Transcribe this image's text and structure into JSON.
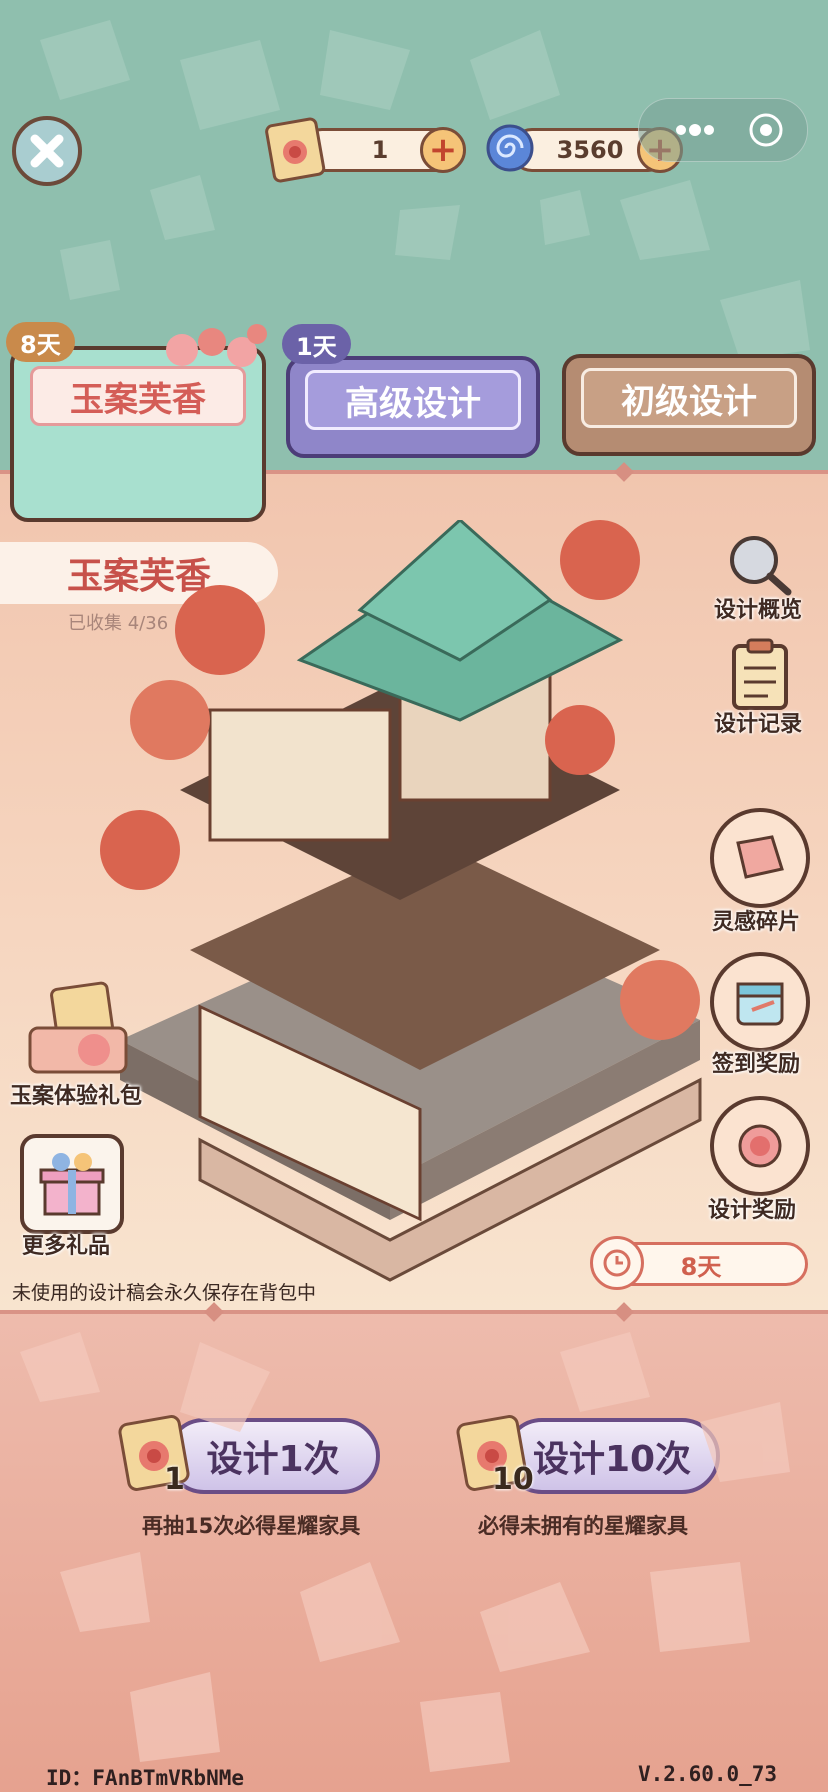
{
  "topbar": {
    "ticket_count": "1",
    "gem_count": "3560"
  },
  "tabs": [
    {
      "label": "玉案芙香",
      "badge": "8天"
    },
    {
      "label": "高级设计",
      "badge": "1天"
    },
    {
      "label": "初级设计"
    }
  ],
  "banner": {
    "title": "玉案芙香",
    "collected": "已收集 4/36"
  },
  "side_buttons": [
    {
      "label": "设计概览",
      "icon": "magnifier-icon"
    },
    {
      "label": "设计记录",
      "icon": "clipboard-icon"
    },
    {
      "label": "灵感碎片",
      "icon": "puzzle-icon"
    },
    {
      "label": "签到奖励",
      "icon": "calendar-icon"
    },
    {
      "label": "设计奖励",
      "icon": "rose-icon"
    }
  ],
  "left_buttons": [
    {
      "label": "玉案体验礼包",
      "icon": "gift-pack-icon"
    },
    {
      "label": "更多礼品",
      "icon": "gift-box-icon"
    }
  ],
  "timer": "8天",
  "note": "未使用的设计稿会永久保存在背包中",
  "design_buttons": [
    {
      "label": "设计1次",
      "count": "1",
      "sub": "再抽15次必得星耀家具"
    },
    {
      "label": "设计10次",
      "count": "10",
      "sub": "必得未拥有的星耀家具"
    }
  ],
  "footer": {
    "id": "ID：FAnBTmVRbNMe",
    "version": "V.2.60.0_73"
  },
  "colors": {
    "accent_purple": "#6a4d86",
    "tab_green": "#a8e0cf",
    "tab_purple": "#8f86c9",
    "tab_brown": "#b58c72"
  }
}
